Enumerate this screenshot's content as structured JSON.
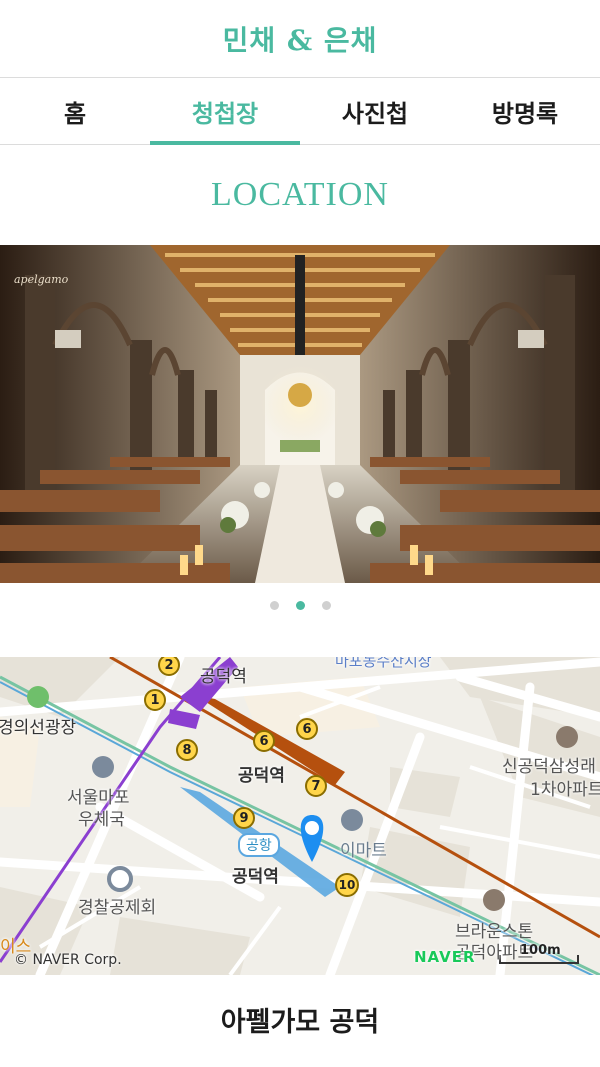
{
  "header": {
    "title": "민채 & 은채"
  },
  "tabs": [
    {
      "label": "홈",
      "active": false
    },
    {
      "label": "청첩장",
      "active": true
    },
    {
      "label": "사진첩",
      "active": false
    },
    {
      "label": "방명록",
      "active": false
    }
  ],
  "section": {
    "title": "LOCATION"
  },
  "photo": {
    "watermark": "apelgamo",
    "slides_total": 3,
    "active_slide": 2
  },
  "map": {
    "labels": {
      "station_top": "공덕역",
      "market": "마포농수산시장",
      "plaza": "경의선광장",
      "post_office_1": "서울마포",
      "post_office_2": "우체국",
      "station_mid": "공덕역",
      "airport_badge": "공항",
      "station_bottom": "공덕역",
      "emart": "이마트",
      "apt1_1": "신공덕삼성래",
      "apt1_2": "1차아파트",
      "police": "경찰공제회",
      "brownstone_1": "브라운스톤",
      "brownstone_2": "공덕아파트",
      "edge_left": "이스"
    },
    "exits": [
      "1",
      "2",
      "6",
      "6",
      "7",
      "8",
      "9",
      "10"
    ],
    "copyright": "© NAVER Corp.",
    "provider": "NAVER",
    "scale": "100m"
  },
  "venue": {
    "name": "아펠가모 공덕"
  },
  "colors": {
    "accent": "#4ab9a0",
    "line5": "#8b3fd0",
    "line6": "#b5500e",
    "airport": "#5ba7e0",
    "gyeongui": "#77c4a3"
  }
}
